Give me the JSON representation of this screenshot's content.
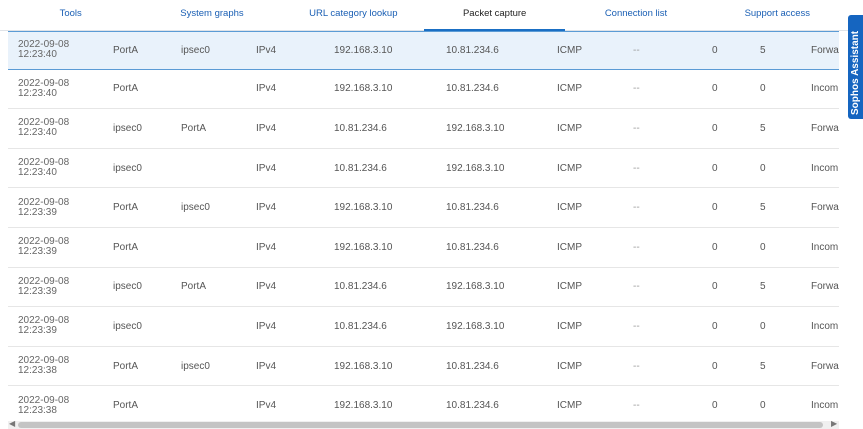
{
  "tabs": [
    {
      "label": "Tools"
    },
    {
      "label": "System graphs"
    },
    {
      "label": "URL category lookup"
    },
    {
      "label": "Packet capture"
    },
    {
      "label": "Connection list"
    },
    {
      "label": "Support access"
    }
  ],
  "active_tab": "Packet capture",
  "assistant_label": "Sophos Assistant",
  "rows": [
    {
      "date": "2022-09-08",
      "time": "12:23:40",
      "in": "PortA",
      "out": "ipsec0",
      "ether": "IPv4",
      "src": "192.168.3.10",
      "dst": "10.81.234.6",
      "proto": "ICMP",
      "dash": "--",
      "n1": "0",
      "n2": "5",
      "action": "Forwar"
    },
    {
      "date": "2022-09-08",
      "time": "12:23:40",
      "in": "PortA",
      "out": "",
      "ether": "IPv4",
      "src": "192.168.3.10",
      "dst": "10.81.234.6",
      "proto": "ICMP",
      "dash": "--",
      "n1": "0",
      "n2": "0",
      "action": "Incom"
    },
    {
      "date": "2022-09-08",
      "time": "12:23:40",
      "in": "ipsec0",
      "out": "PortA",
      "ether": "IPv4",
      "src": "10.81.234.6",
      "dst": "192.168.3.10",
      "proto": "ICMP",
      "dash": "--",
      "n1": "0",
      "n2": "5",
      "action": "Forwar"
    },
    {
      "date": "2022-09-08",
      "time": "12:23:40",
      "in": "ipsec0",
      "out": "",
      "ether": "IPv4",
      "src": "10.81.234.6",
      "dst": "192.168.3.10",
      "proto": "ICMP",
      "dash": "--",
      "n1": "0",
      "n2": "0",
      "action": "Incom"
    },
    {
      "date": "2022-09-08",
      "time": "12:23:39",
      "in": "PortA",
      "out": "ipsec0",
      "ether": "IPv4",
      "src": "192.168.3.10",
      "dst": "10.81.234.6",
      "proto": "ICMP",
      "dash": "--",
      "n1": "0",
      "n2": "5",
      "action": "Forwar"
    },
    {
      "date": "2022-09-08",
      "time": "12:23:39",
      "in": "PortA",
      "out": "",
      "ether": "IPv4",
      "src": "192.168.3.10",
      "dst": "10.81.234.6",
      "proto": "ICMP",
      "dash": "--",
      "n1": "0",
      "n2": "0",
      "action": "Incom"
    },
    {
      "date": "2022-09-08",
      "time": "12:23:39",
      "in": "ipsec0",
      "out": "PortA",
      "ether": "IPv4",
      "src": "10.81.234.6",
      "dst": "192.168.3.10",
      "proto": "ICMP",
      "dash": "--",
      "n1": "0",
      "n2": "5",
      "action": "Forwar"
    },
    {
      "date": "2022-09-08",
      "time": "12:23:39",
      "in": "ipsec0",
      "out": "",
      "ether": "IPv4",
      "src": "10.81.234.6",
      "dst": "192.168.3.10",
      "proto": "ICMP",
      "dash": "--",
      "n1": "0",
      "n2": "0",
      "action": "Incom"
    },
    {
      "date": "2022-09-08",
      "time": "12:23:38",
      "in": "PortA",
      "out": "ipsec0",
      "ether": "IPv4",
      "src": "192.168.3.10",
      "dst": "10.81.234.6",
      "proto": "ICMP",
      "dash": "--",
      "n1": "0",
      "n2": "5",
      "action": "Forwar"
    },
    {
      "date": "2022-09-08",
      "time": "12:23:38",
      "in": "PortA",
      "out": "",
      "ether": "IPv4",
      "src": "192.168.3.10",
      "dst": "10.81.234.6",
      "proto": "ICMP",
      "dash": "--",
      "n1": "0",
      "n2": "0",
      "action": "Incom"
    }
  ],
  "selected_row": 0,
  "colors": {
    "accent": "#1565c0",
    "tab_link": "#1a5fb4",
    "selected_bg": "#e9f2fb",
    "selected_border": "#5b9bd5"
  }
}
